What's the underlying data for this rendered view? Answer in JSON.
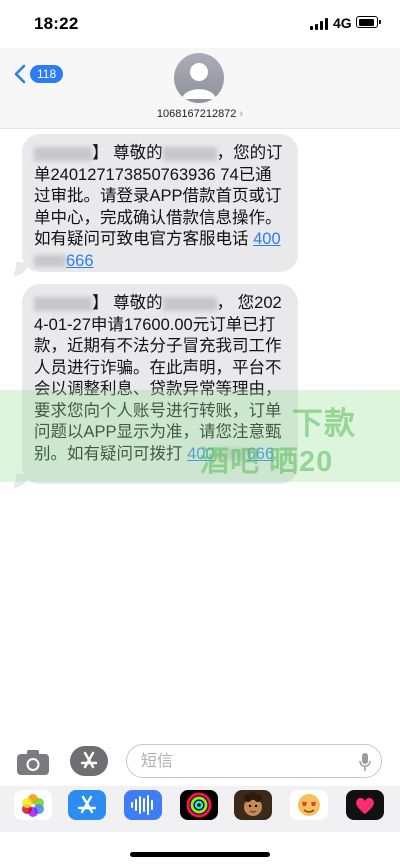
{
  "status_bar": {
    "time": "18:22",
    "network": "4G"
  },
  "header": {
    "back_count": "118",
    "contact_number": "1068167212872"
  },
  "messages": [
    {
      "prefix": "【",
      "mid": "】 尊敬的",
      "text": "，您的订单240127173850763936 74已通过审批。请登录APP借款首页或订单中心，完成确认借款信息操作。如有疑问可致电官方客服电话",
      "link_start": "400",
      "link_end": "666"
    },
    {
      "mid": "】 尊敬的",
      "text": "， 您2024-01-27申请17600.00元订单已打款，近期有不法分子冒充我司工作人员进行诈骗。在此声明，平台不会以调整利息、贷款异常等理由，要求您向个人账号进行转账，订单问题以APP显示为准，请您注意甄别。如有疑问可拨打",
      "link_start": "400",
      "link_end": "666"
    }
  ],
  "watermark": {
    "line1": "下款",
    "line2": "酒吧 晒20"
  },
  "input": {
    "placeholder": "短信"
  },
  "colors": {
    "accent": "#2b7cf6",
    "bubble": "#e9e9eb"
  }
}
